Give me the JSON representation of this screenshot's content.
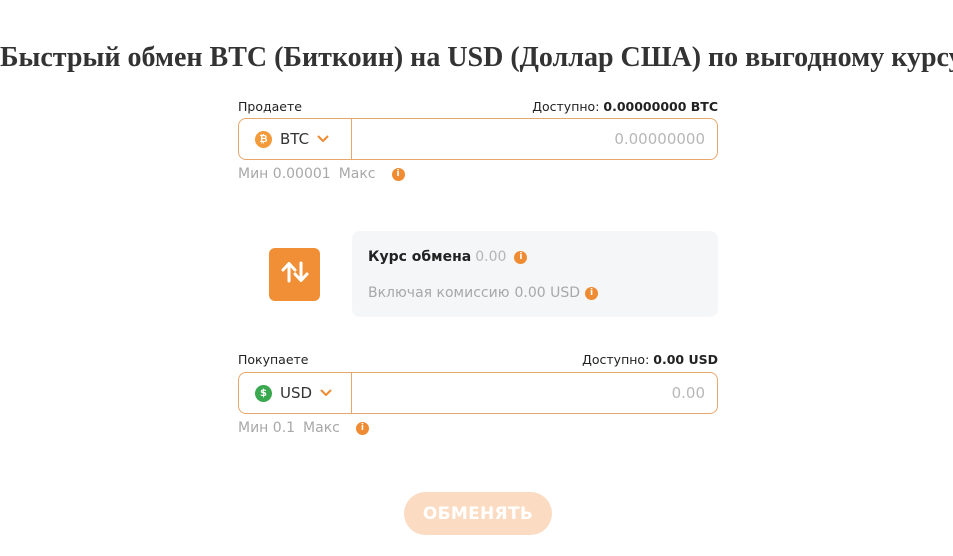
{
  "title": "Быстрый обмен BTC (Биткоин) на USD (Доллар США) по выгодному курсу",
  "sell": {
    "label": "Продаете",
    "available_label": "Доступно:",
    "available_value": "0.00000000 BTC",
    "currency": "BTC",
    "coin_symbol": "₿",
    "amount_value": "",
    "amount_placeholder": "0.00000000",
    "min_text": "Мин 0.00001",
    "max_text": "Макс"
  },
  "rate": {
    "label": "Курс обмена",
    "value": "0.00",
    "commission_label": "Включая комиссию",
    "commission_value": "0.00 USD"
  },
  "buy": {
    "label": "Покупаете",
    "available_label": "Доступно:",
    "available_value": "0.00 USD",
    "currency": "USD",
    "coin_symbol": "$",
    "amount_value": "",
    "amount_placeholder": "0.00",
    "min_text": "Мин 0.1",
    "max_text": "Макс"
  },
  "exchange_button": "ОБМЕНЯТЬ",
  "colors": {
    "accent": "#f08f35",
    "border": "#e7a76c",
    "btc": "#f39a3a",
    "usd": "#3aa84f",
    "button_disabled": "#fbdcc2",
    "rate_bg": "#f4f6f8"
  },
  "icons": {
    "swap": "swap-arrows-icon",
    "info": "info-icon",
    "chevron": "chevron-down-icon"
  }
}
